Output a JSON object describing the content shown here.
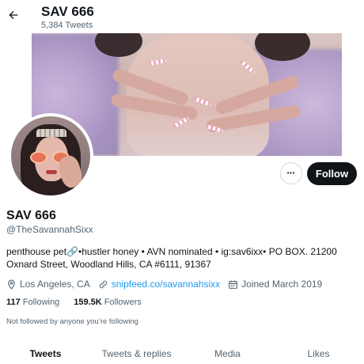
{
  "header": {
    "title": "SAV 666",
    "tweet_count": "5,384 Tweets"
  },
  "profile": {
    "name": "SAV 666",
    "handle": "@TheSavannahSixx",
    "bio_line1": "penthouse pet🔗•hustler honey • AVN nominated • ig:sav6ixx• PO BOX. 21200",
    "bio_line2": "Oxnard Street, Woodland Hills, CA #6111, 91367",
    "location": "Los Angeles, CA",
    "website": "snipfeed.co/savannahsixx",
    "joined": "Joined March 2019",
    "following_count": "117",
    "following_label": "Following",
    "followers_count": "159.5K",
    "followers_label": "Followers",
    "not_followed_text": "Not followed by anyone you’re following"
  },
  "actions": {
    "more_label": "•••",
    "follow_label": "Follow"
  },
  "tabs": [
    {
      "label": "Tweets",
      "active": true
    },
    {
      "label": "Tweets & replies",
      "active": false
    },
    {
      "label": "Media",
      "active": false
    },
    {
      "label": "Likes",
      "active": false
    }
  ],
  "colors": {
    "link": "#1d9bf0",
    "text": "#0f1419",
    "secondary": "#536471",
    "follow_bg": "#0f1419"
  },
  "icons": {
    "back": "arrow-left-icon",
    "location": "location-pin-icon",
    "link": "link-icon",
    "calendar": "calendar-icon"
  }
}
